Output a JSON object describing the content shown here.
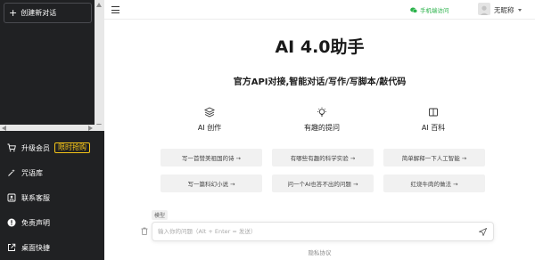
{
  "sidebar": {
    "new_chat_label": "创建新对话",
    "menu": [
      {
        "label": "升级会员",
        "icon": "cart-icon",
        "badge": "限时抢购"
      },
      {
        "label": "咒语库",
        "icon": "magic-wand-icon"
      },
      {
        "label": "联系客服",
        "icon": "contact-icon"
      },
      {
        "label": "免责声明",
        "icon": "alert-icon"
      },
      {
        "label": "桌面快捷",
        "icon": "external-link-icon"
      }
    ]
  },
  "header": {
    "phone_access_label": "手机端访问",
    "username": "无昵称"
  },
  "main": {
    "title": "AI 4.0助手",
    "subtitle": "官方API对接,智能对话/写作/写脚本/敲代码",
    "columns": [
      {
        "label": "AI 创作",
        "icon": "layers-icon"
      },
      {
        "label": "有趣的提问",
        "icon": "lightbulb-icon"
      },
      {
        "label": "AI 百科",
        "icon": "book-icon"
      }
    ],
    "prompts": [
      "写一首赞美祖国的诗 →",
      "有哪些有趣的科学实验 →",
      "简单解释一下人工智能 →",
      "写一篇科幻小说 →",
      "问一个AI也答不出的问题 →",
      "红烧牛肉的做法 →"
    ]
  },
  "composer": {
    "model_label": "模型",
    "placeholder": "输入你的问题（Alt + Enter = 发送）",
    "privacy_label": "隐私协议"
  },
  "colors": {
    "sidebar_bg": "#202123",
    "promo_accent": "#f5c518",
    "wechat_green": "#2ab24a"
  }
}
